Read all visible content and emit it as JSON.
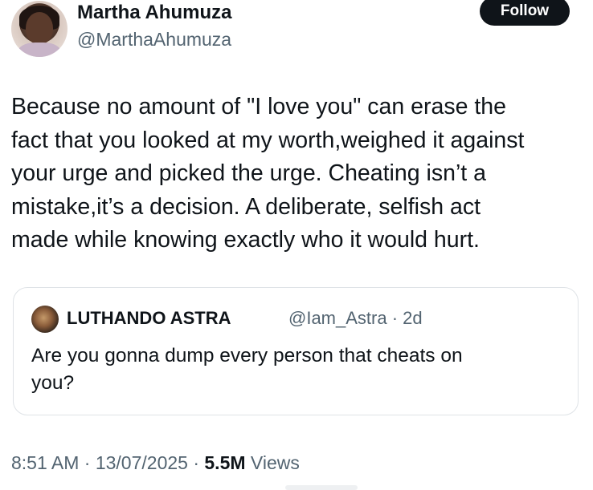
{
  "author": {
    "display_name": "Martha Ahumuza",
    "handle": "@MarthaAhumuza"
  },
  "follow_label": "Follow",
  "tweet": {
    "lines": [
      "Because no amount of \"I love you\" can erase the",
      "fact that you looked at my worth,weighed it against",
      "your urge  and picked the urge. Cheating isn’t a",
      "mistake,it’s a decision. A deliberate, selfish act",
      "made while knowing exactly who it would hurt."
    ]
  },
  "quote": {
    "display_name": "LUTHANDO ASTRA",
    "handle_time": "@Iam_Astra · 2d",
    "lines": [
      "Are you gonna dump every person that cheats on",
      "you?"
    ]
  },
  "meta": {
    "time_date": "8:51 AM · 13/07/2025 · ",
    "views_count": "5.5M",
    "views_label": " Views"
  }
}
